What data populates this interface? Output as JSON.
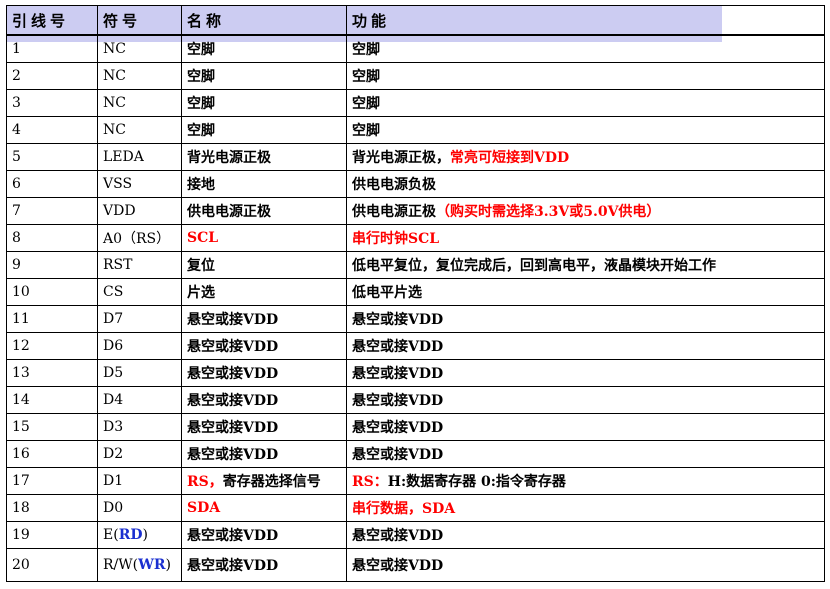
{
  "header": {
    "pin": "引线号",
    "symbol": "符号",
    "name": "名称",
    "function": "功能"
  },
  "rows": [
    {
      "pin": "1",
      "symbol": "NC",
      "name": "空脚",
      "function": "空脚"
    },
    {
      "pin": "2",
      "symbol": "NC",
      "name": "空脚",
      "function": "空脚"
    },
    {
      "pin": "3",
      "symbol": "NC",
      "name": "空脚",
      "function": "空脚"
    },
    {
      "pin": "4",
      "symbol": "NC",
      "name": "空脚",
      "function": "空脚"
    },
    {
      "pin": "5",
      "symbol": "LEDA",
      "name": "背光电源正极",
      "function": "背光电源正极，",
      "function_red": "常亮可短接到VDD"
    },
    {
      "pin": "6",
      "symbol": "VSS",
      "name": "接地",
      "function": "供电电源负极"
    },
    {
      "pin": "7",
      "symbol": "VDD",
      "name": "供电电源正极",
      "function": "供电电源正极",
      "function_red": "（购买时需选择3.3V或5.0V供电）"
    },
    {
      "pin": "8",
      "symbol": "A0（RS）",
      "name_red": "SCL",
      "function_red": "串行时钟SCL"
    },
    {
      "pin": "9",
      "symbol": "RST",
      "name": "复位",
      "function": "低电平复位，复位完成后，回到高电平，液晶模块开始工作"
    },
    {
      "pin": "10",
      "symbol": "CS",
      "name": "片选",
      "function": "低电平片选"
    },
    {
      "pin": "11",
      "symbol": "D7",
      "name": "悬空或接VDD",
      "function": "悬空或接VDD"
    },
    {
      "pin": "12",
      "symbol": "D6",
      "name": "悬空或接VDD",
      "function": "悬空或接VDD"
    },
    {
      "pin": "13",
      "symbol": "D5",
      "name": "悬空或接VDD",
      "function": "悬空或接VDD"
    },
    {
      "pin": "14",
      "symbol": "D4",
      "name": "悬空或接VDD",
      "function": "悬空或接VDD"
    },
    {
      "pin": "15",
      "symbol": "D3",
      "name": "悬空或接VDD",
      "function": "悬空或接VDD"
    },
    {
      "pin": "16",
      "symbol": "D2",
      "name": "悬空或接VDD",
      "function": "悬空或接VDD"
    },
    {
      "pin": "17",
      "symbol": "D1",
      "name_red": "RS，",
      "name_rest": "寄存器选择信号",
      "function_red": "RS：",
      "function_rest": "H:数据寄存器 0:指令寄存器"
    },
    {
      "pin": "18",
      "symbol": "D0",
      "name_red": "SDA",
      "function_red": "串行数据，SDA"
    },
    {
      "pin": "19",
      "symbol_pre": "E(",
      "symbol_blue": "RD",
      "symbol_post": ")",
      "name": "悬空或接VDD",
      "function": "悬空或接VDD"
    },
    {
      "pin": "20",
      "symbol_pre": "R/W(",
      "symbol_blue": "WR",
      "symbol_post": ")",
      "name": "悬空或接VDD",
      "function": "悬空或接VDD"
    }
  ],
  "colors": {
    "header_band": "#ccccf2",
    "emphasis_red": "#ff0000",
    "signal_blue": "#1a2fd0"
  }
}
